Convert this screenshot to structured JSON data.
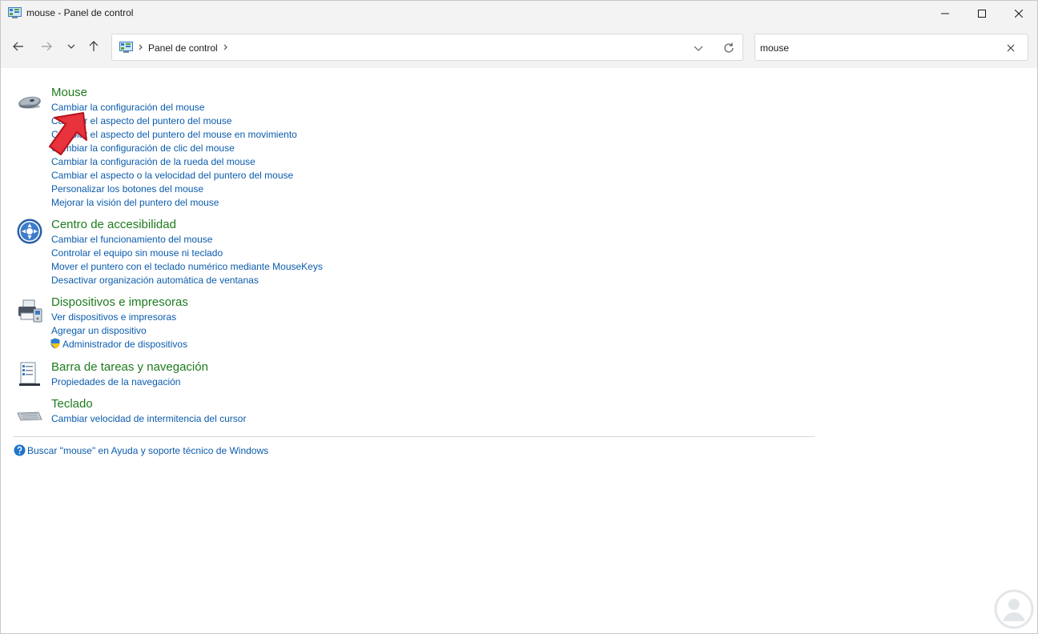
{
  "window": {
    "title": "mouse - Panel de control"
  },
  "nav": {
    "breadcrumb_root": "Panel de control",
    "search_value": "mouse"
  },
  "groups": [
    {
      "title": "Mouse",
      "icon": "mouse-icon",
      "links": [
        "Cambiar la configuración del mouse",
        "Cambiar el aspecto del puntero del mouse",
        "Cambiar el aspecto del puntero del mouse en movimiento",
        "Cambiar la configuración de clic del mouse",
        "Cambiar la configuración de la rueda del mouse",
        "Cambiar el aspecto o la velocidad del puntero del mouse",
        "Personalizar los botones del mouse",
        "Mejorar la visión del puntero del mouse"
      ]
    },
    {
      "title": "Centro de accesibilidad",
      "icon": "accessibility-icon",
      "links": [
        "Cambiar el funcionamiento del mouse",
        "Controlar el equipo sin mouse ni teclado",
        "Mover el puntero con el teclado numérico mediante MouseKeys",
        "Desactivar organización automática de ventanas"
      ]
    },
    {
      "title": "Dispositivos e impresoras",
      "icon": "printer-icon",
      "links": [
        "Ver dispositivos e impresoras",
        "Agregar un dispositivo",
        "Administrador de dispositivos"
      ]
    },
    {
      "title": "Barra de tareas y navegación",
      "icon": "taskbar-icon",
      "links": [
        "Propiedades de la navegación"
      ]
    },
    {
      "title": "Teclado",
      "icon": "keyboard-icon",
      "links": [
        "Cambiar velocidad de intermitencia del cursor"
      ]
    }
  ],
  "help": {
    "label": "Buscar \"mouse\" en Ayuda y soporte técnico de Windows"
  },
  "colors": {
    "group_title": "#1e7b1e",
    "link": "#0b5cad",
    "chrome": "#f3f3f3",
    "annotation_arrow": "#e8323c"
  }
}
